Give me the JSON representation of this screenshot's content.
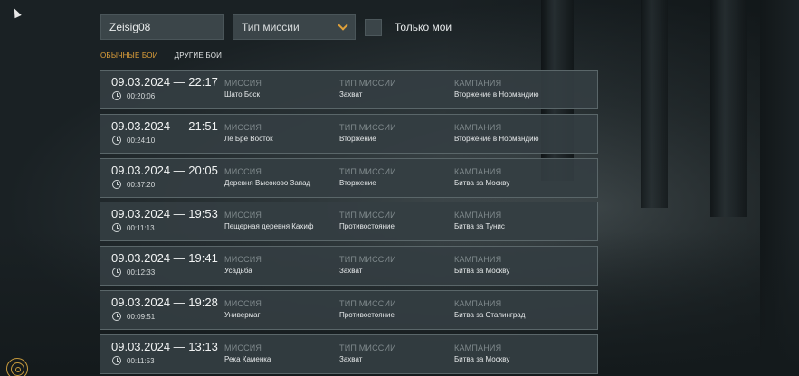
{
  "search": {
    "value": "Zeisig08"
  },
  "mission_type_select": {
    "selected": "Тип миссии"
  },
  "only_mine": {
    "label": "Только мои",
    "checked": false
  },
  "tabs": [
    {
      "label": "ОБЫЧНЫЕ БОИ",
      "active": true
    },
    {
      "label": "ДРУГИЕ БОИ",
      "active": false
    }
  ],
  "columns": {
    "mission": "МИССИЯ",
    "mission_type": "ТИП МИССИИ",
    "campaign": "КАМПАНИЯ"
  },
  "battles": [
    {
      "datetime": "09.03.2024 — 22:17",
      "duration": "00:20:06",
      "mission": "Шато Боск",
      "mission_type": "Захват",
      "campaign": "Вторжение в Нормандию"
    },
    {
      "datetime": "09.03.2024 — 21:51",
      "duration": "00:24:10",
      "mission": "Ле Бре Восток",
      "mission_type": "Вторжение",
      "campaign": "Вторжение в Нормандию"
    },
    {
      "datetime": "09.03.2024 — 20:05",
      "duration": "00:37:20",
      "mission": "Деревня Высоково Запад",
      "mission_type": "Вторжение",
      "campaign": "Битва за Москву"
    },
    {
      "datetime": "09.03.2024 — 19:53",
      "duration": "00:11:13",
      "mission": "Пещерная деревня Кахиф",
      "mission_type": "Противостояние",
      "campaign": "Битва за Тунис"
    },
    {
      "datetime": "09.03.2024 — 19:41",
      "duration": "00:12:33",
      "mission": "Усадьба",
      "mission_type": "Захват",
      "campaign": "Битва за Москву"
    },
    {
      "datetime": "09.03.2024 — 19:28",
      "duration": "00:09:51",
      "mission": "Универмаг",
      "mission_type": "Противостояние",
      "campaign": "Битва за Сталинград"
    },
    {
      "datetime": "09.03.2024 — 13:13",
      "duration": "00:11:53",
      "mission": "Река Каменка",
      "mission_type": "Захват",
      "campaign": "Битва за Москву"
    }
  ],
  "colors": {
    "accent": "#e0a13a",
    "panel": "#343e42",
    "muted": "#7f898c"
  },
  "icons": {
    "clock": "clock-icon",
    "dropdown": "chevron-down-icon",
    "logo": "logo-icon"
  }
}
